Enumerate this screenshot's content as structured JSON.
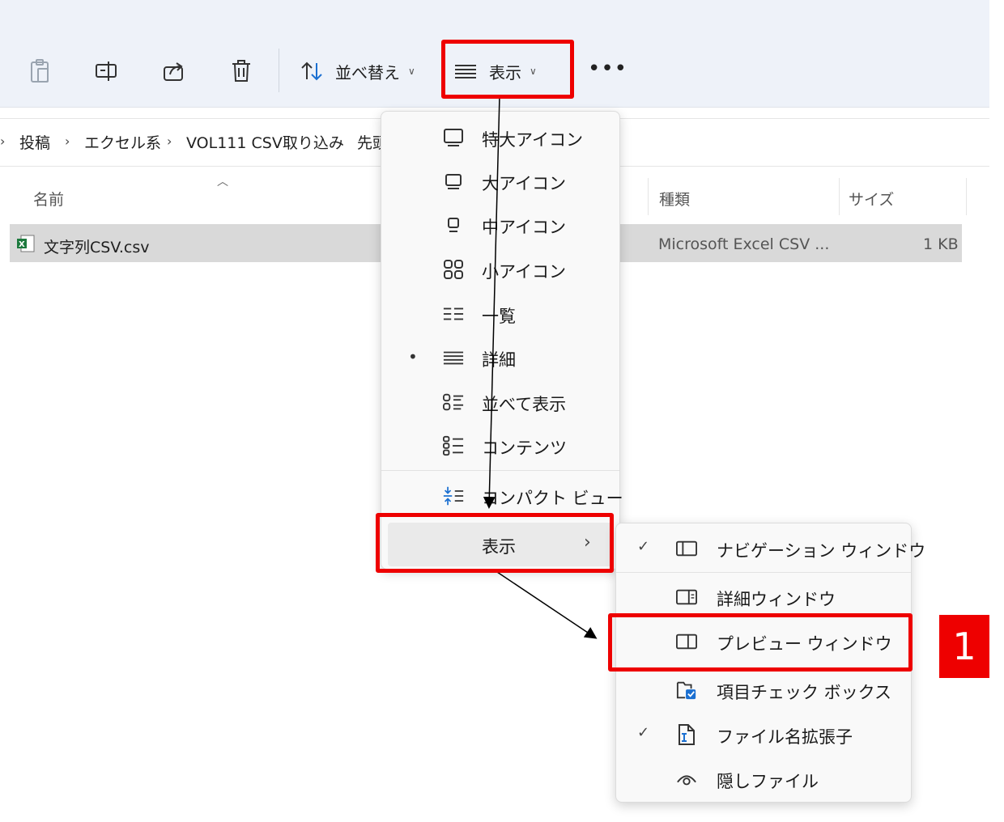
{
  "toolbar": {
    "sort_label": "並べ替え",
    "view_label": "表示",
    "more_label": "•••"
  },
  "breadcrumb": {
    "items": [
      "投稿",
      "エクセル系",
      "VOL111 CSV取り込み",
      "先頭"
    ]
  },
  "columns": {
    "name": "名前",
    "type": "種類",
    "size": "サイズ"
  },
  "file": {
    "name": "文字列CSV.csv",
    "type": "Microsoft Excel CSV ...",
    "size": "1 KB"
  },
  "view_menu": {
    "items": [
      {
        "label": "特大アイコン",
        "icon": "monitor-icon"
      },
      {
        "label": "大アイコン",
        "icon": "monitor-icon"
      },
      {
        "label": "中アイコン",
        "icon": "monitor-icon"
      },
      {
        "label": "小アイコン",
        "icon": "grid-icon"
      },
      {
        "label": "一覧",
        "icon": "list-icon"
      },
      {
        "label": "詳細",
        "icon": "details-icon",
        "selected": true
      },
      {
        "label": "並べて表示",
        "icon": "tiles-icon"
      },
      {
        "label": "コンテンツ",
        "icon": "content-icon"
      },
      {
        "label": "コンパクト ビュー",
        "icon": "compact-icon"
      },
      {
        "label": "表示",
        "icon": "chevron-right-icon"
      }
    ]
  },
  "show_submenu": {
    "items": [
      {
        "label": "ナビゲーション ウィンドウ",
        "checked": true,
        "icon": "nav-pane-icon"
      },
      {
        "label": "詳細ウィンドウ",
        "checked": false,
        "icon": "details-pane-icon"
      },
      {
        "label": "プレビュー ウィンドウ",
        "checked": false,
        "icon": "preview-pane-icon"
      },
      {
        "label": "項目チェック ボックス",
        "checked": false,
        "icon": "checkbox-icon"
      },
      {
        "label": "ファイル名拡張子",
        "checked": true,
        "icon": "file-ext-icon"
      },
      {
        "label": "隠しファイル",
        "checked": false,
        "icon": "eye-icon"
      }
    ]
  },
  "annotation": {
    "step_number": "1",
    "highlight_color": "#ee0000"
  }
}
